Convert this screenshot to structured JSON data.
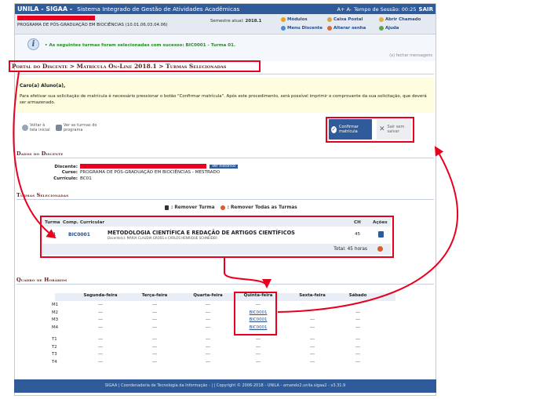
{
  "topbar": {
    "brand": "UNILA - SIGAA -",
    "system": "Sistema Integrado de Gestão de Atividades Acadêmicas",
    "font_controls": "A+ A-",
    "session_label": "Tempo de Sessão: 00:25",
    "exit_label": "SAIR"
  },
  "user_strip": {
    "program": "PROGRAMA DE PÓS-GRADUAÇÃO EM BIOCIÊNCIAS (10.01.06.03.04.06)",
    "semester_label": "Semestre atual:",
    "semester_value": "2018.1",
    "links": [
      "Módulos",
      "Caixa Postal",
      "Abrir Chamado",
      "Menu Discente",
      "Alterar senha",
      "Ajuda"
    ]
  },
  "message": {
    "text": "• As seguintes turmas foram selecionadas com sucesso: BIC0001 - Turma 01.",
    "close": "(x) fechar mensagens"
  },
  "breadcrumb": "Portal do Discente > Matrícula On-Line 2018.1 > Turmas Selecionadas",
  "notice": {
    "greeting": "Caro(a) Aluno(a),",
    "body": "Para efetivar sua solicitação de matrícula é necessário pressionar o botão \"Confirmar matrícula\". Após este procedimento, será possível imprimir o comprovante da sua solicitação, que deverá ser armazenado."
  },
  "actions": {
    "back": "Voltar à tela inicial",
    "view": "Ver as turmas do programa",
    "confirm": "Confirmar matrícula",
    "skip": "Sair sem salvar"
  },
  "student": {
    "section": "Dados do Discente",
    "discente_label": "Discente:",
    "history_btn": "Ver histórico",
    "curso_label": "Curso:",
    "curso_value": "PROGRAMA DE PÓS-GRADUAÇÃO EM BIOCIÊNCIAS - MESTRADO",
    "curriculo_label": "Currículo:",
    "curriculo_value": "BC01"
  },
  "turmas": {
    "section": "Turmas Selecionadas",
    "legend_remove": ": Remover Turma",
    "legend_remove_all": ": Remover Todas as Turmas",
    "headers": [
      "Turma",
      "Comp. Curricular",
      "CH",
      "Ações"
    ],
    "row": {
      "turma": "01",
      "code": "BIC0001",
      "name": "METODOLOGIA CIENTÍFICA E REDAÇÃO DE ARTIGOS CIENTÍFICOS",
      "docentes": "Docente(s): MARIA CLAUDIA GROSS e CARLOS HENRIQUE SCHNEIDER",
      "ch": "45"
    },
    "total": "Total: 45 horas"
  },
  "schedule": {
    "section": "Quadro de Horários",
    "days": [
      "Segunda-feira",
      "Terça-feira",
      "Quarta-feira",
      "Quinta-feira",
      "Sexta-feira",
      "Sábado"
    ],
    "rows": [
      {
        "slot": "M1",
        "cells": [
          "---",
          "---",
          "---",
          "---",
          "",
          ""
        ]
      },
      {
        "slot": "M2",
        "cells": [
          "---",
          "---",
          "---",
          "BIC0001",
          "",
          "---"
        ]
      },
      {
        "slot": "M3",
        "cells": [
          "---",
          "---",
          "---",
          "BIC0001",
          "---",
          "---"
        ]
      },
      {
        "slot": "M4",
        "cells": [
          "---",
          "---",
          "---",
          "BIC0001",
          "---",
          "---"
        ]
      },
      {
        "slot": "T1",
        "cells": [
          "---",
          "---",
          "---",
          "---",
          "---",
          "---"
        ]
      },
      {
        "slot": "T2",
        "cells": [
          "---",
          "---",
          "---",
          "---",
          "---",
          "---"
        ]
      },
      {
        "slot": "T3",
        "cells": [
          "---",
          "---",
          "---",
          "---",
          "---",
          "---"
        ]
      },
      {
        "slot": "T4",
        "cells": [
          "---",
          "---",
          "---",
          "---",
          "---",
          "---"
        ]
      }
    ]
  },
  "footer": "SIGAA | Coordenadoria de Tecnologia da Informação - | | Copyright © 2006-2018 - UNILA - amarelo2.unila.sigaa2 - v3.31.9",
  "colors": {
    "accent": "#2f5b9a",
    "highlight": "#e8001e",
    "success": "#2b8a2b"
  }
}
